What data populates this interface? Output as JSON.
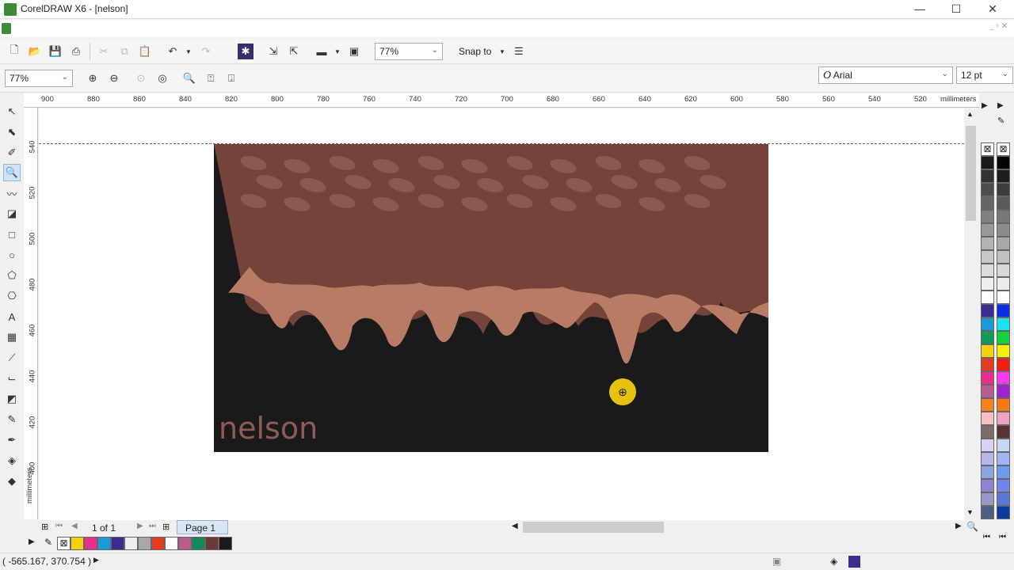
{
  "window": {
    "title": "CorelDRAW X6 - [nelson]",
    "minimize": "—",
    "maximize": "☐",
    "close": "✕"
  },
  "toolbar": {
    "zoom_level": "77%",
    "snap_to": "Snap to"
  },
  "zoombar": {
    "zoom_level": "77%"
  },
  "property_bar": {
    "font_name": "Arial",
    "font_size": "12 pt",
    "font_icon": "O"
  },
  "ruler": {
    "units": "millimeters",
    "h_labels": [
      "900",
      "880",
      "860",
      "840",
      "820",
      "800",
      "780",
      "760",
      "740",
      "720",
      "700",
      "680",
      "660",
      "640",
      "620",
      "600",
      "580",
      "560",
      "540",
      "520"
    ],
    "v_labels": [
      "540",
      "520",
      "500",
      "480",
      "460",
      "440",
      "420",
      "400"
    ],
    "v_units": "millimeters"
  },
  "artwork": {
    "text": "nelson",
    "colors": {
      "top": "#74433a",
      "bottom": "#1b1a1a",
      "drip": "#b97b63",
      "pattern": "#8a5a52",
      "text": "#8c5d57"
    }
  },
  "page_nav": {
    "page_count": "1 of 1",
    "tab": "Page 1"
  },
  "document_palette": [
    "#f5d20f",
    "#e8308a",
    "#1a9ad6",
    "#3a2d8f",
    "#eeeeee",
    "#a8a8a8",
    "#e43c21",
    "#ffffff",
    "#b85c8e",
    "#118a5a",
    "#6b3a36",
    "#1b1a1a"
  ],
  "palette_left": [
    "#1a1a1a",
    "#333333",
    "#4d4d4d",
    "#666666",
    "#808080",
    "#999999",
    "#b3b3b3",
    "#c7c7c7",
    "#dcdcdc",
    "#efefef",
    "#ffffff",
    "#3a2d8f",
    "#1a9ad6",
    "#0f9a5a",
    "#f5d20f",
    "#e43c21",
    "#e8308a",
    "#b85c8e",
    "#f58220",
    "#f7c0c0",
    "#7a6e66",
    "#d6d4f0",
    "#b8b6e6",
    "#8aa6dc",
    "#8c84cf",
    "#9a98c8",
    "#4d6080"
  ],
  "palette_right": [
    "#050505",
    "#1e1e1e",
    "#3c3c3c",
    "#5a5a5a",
    "#787878",
    "#8c8c8c",
    "#a8a8a8",
    "#c0c0c0",
    "#d8d8d8",
    "#ececec",
    "#ffffff",
    "#0a2ee6",
    "#18e4f0",
    "#14d23c",
    "#f5f00a",
    "#f01e14",
    "#f53cf0",
    "#a020d2",
    "#f57814",
    "#f0a0c0",
    "#5a3236",
    "#c8d6f8",
    "#a0b4f8",
    "#6c9cf0",
    "#6e84f0",
    "#5a78d8",
    "#0a3ca0"
  ],
  "status": {
    "coordinates": "( -565.167, 370.754 )"
  }
}
